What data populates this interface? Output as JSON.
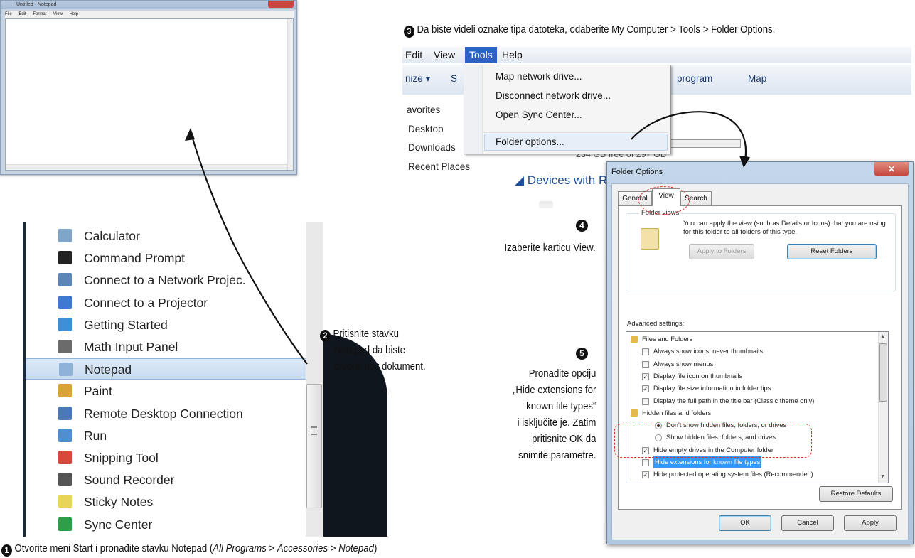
{
  "notepad_window": {
    "title": "Untitled - Notepad",
    "menu": [
      "File",
      "Edit",
      "Format",
      "View",
      "Help"
    ]
  },
  "start_menu": {
    "items": [
      {
        "label": "Calculator",
        "icon": "calculator-icon",
        "color": "#7fa6c9"
      },
      {
        "label": "Command Prompt",
        "icon": "command-prompt-icon",
        "color": "#222222"
      },
      {
        "label": "Connect to a Network Projec.",
        "icon": "network-projector-icon",
        "color": "#5d86b8"
      },
      {
        "label": "Connect to a Projector",
        "icon": "projector-icon",
        "color": "#3e7ad0"
      },
      {
        "label": "Getting Started",
        "icon": "getting-started-icon",
        "color": "#3f8fd6"
      },
      {
        "label": "Math Input Panel",
        "icon": "math-input-icon",
        "color": "#6b6b6b"
      },
      {
        "label": "Notepad",
        "icon": "notepad-icon",
        "color": "#8fb3d8"
      },
      {
        "label": "Paint",
        "icon": "paint-icon",
        "color": "#d9a33a"
      },
      {
        "label": "Remote Desktop Connection",
        "icon": "remote-desktop-icon",
        "color": "#4a78b8"
      },
      {
        "label": "Run",
        "icon": "run-icon",
        "color": "#4f8fd0"
      },
      {
        "label": "Snipping Tool",
        "icon": "snipping-tool-icon",
        "color": "#d8493b"
      },
      {
        "label": "Sound Recorder",
        "icon": "microphone-icon",
        "color": "#555555"
      },
      {
        "label": "Sticky Notes",
        "icon": "sticky-notes-icon",
        "color": "#e9d45a"
      },
      {
        "label": "Sync Center",
        "icon": "sync-center-icon",
        "color": "#2f9e48"
      }
    ],
    "highlighted": "Notepad"
  },
  "explorer": {
    "menubar": {
      "edit": "Edit",
      "view": "View",
      "tools": "Tools",
      "help": "Help"
    },
    "toolbar": {
      "organize": "nize ▾",
      "s": "S",
      "program": "program",
      "map": "Map"
    },
    "nav": [
      "avorites",
      "Desktop",
      "Downloads",
      "Recent Places"
    ],
    "tools_menu": [
      "Map network drive...",
      "Disconnect network drive...",
      "Open Sync Center...",
      "Folder options..."
    ],
    "drive_info": "234 GB free of 297 GB",
    "devices_heading": "Devices with R"
  },
  "folder_options": {
    "title": "Folder Options",
    "tabs": [
      "General",
      "View",
      "Search"
    ],
    "folder_views_label": "Folder views",
    "folder_views_text": "You can apply the view (such as Details or Icons) that you are using for this folder to all folders of this type.",
    "apply_to_folders": "Apply to Folders",
    "reset_folders": "Reset Folders",
    "advanced_label": "Advanced settings:",
    "tree": [
      {
        "type": "folder",
        "label": "Files and Folders"
      },
      {
        "type": "check",
        "checked": false,
        "label": "Always show icons, never thumbnails"
      },
      {
        "type": "check",
        "checked": false,
        "label": "Always show menus"
      },
      {
        "type": "check",
        "checked": true,
        "label": "Display file icon on thumbnails"
      },
      {
        "type": "check",
        "checked": true,
        "label": "Display file size information in folder tips"
      },
      {
        "type": "check",
        "checked": false,
        "label": "Display the full path in the title bar (Classic theme only)"
      },
      {
        "type": "folder",
        "label": "Hidden files and folders"
      },
      {
        "type": "radio",
        "checked": true,
        "label": "Don't show hidden files, folders, or drives"
      },
      {
        "type": "radio",
        "checked": false,
        "label": "Show hidden files, folders, and drives"
      },
      {
        "type": "check",
        "checked": true,
        "label": "Hide empty drives in the Computer folder"
      },
      {
        "type": "check",
        "checked": false,
        "selected": true,
        "label": "Hide extensions for known file types"
      },
      {
        "type": "check",
        "checked": true,
        "label": "Hide protected operating system files (Recommended)"
      }
    ],
    "restore_defaults": "Restore Defaults",
    "ok": "OK",
    "cancel": "Cancel",
    "apply": "Apply"
  },
  "callouts": {
    "step1": {
      "number": "1",
      "text_prefix": "Otvorite meni Start i pronađite stavku Notepad (",
      "path_all": "All Programs",
      "sep1": " > ",
      "path_acc": "Accessories",
      "sep2": " > ",
      "path_np": "Notepad",
      "text_suffix": ")"
    },
    "step2": {
      "number": "2",
      "line1": "Pritisnite stavku",
      "line2": "Notepad da biste",
      "line3": "otvorili nov dokument."
    },
    "step3": {
      "number": "3",
      "text": "Da biste videli oznake tipa datoteka, odaberite My Computer > Tools > Folder Options."
    },
    "step4": {
      "number": "4",
      "text": "Izaberite karticu View."
    },
    "step5": {
      "number": "5",
      "line1": "Pronađite opciju",
      "line2": "„Hide extensions for",
      "line3": "known file types“",
      "line4": "i isključite je. Zatim",
      "line5": "pritisnite OK da",
      "line6": "snimite parametre."
    }
  },
  "colors": {
    "highlight": "#c8dcf2",
    "annotation_red": "#d7322b",
    "selection_blue": "#3399ff",
    "dialog_frame": "#b2c8e0"
  }
}
